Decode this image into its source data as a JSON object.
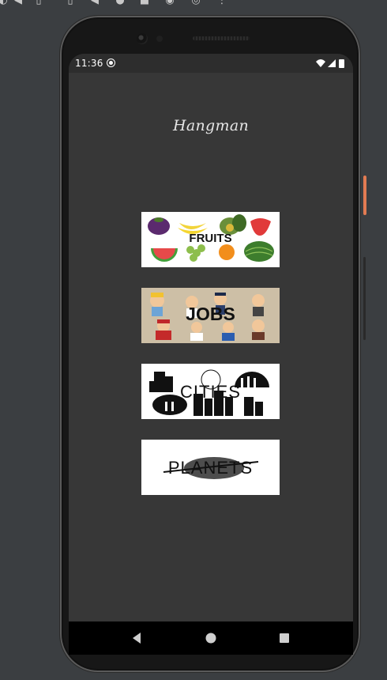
{
  "status_bar": {
    "time": "11:36"
  },
  "app": {
    "title": "Hangman"
  },
  "categories": [
    {
      "label": "FRUITS"
    },
    {
      "label": "JOBS"
    },
    {
      "label": "CITIES"
    },
    {
      "label": "PLANETS"
    }
  ],
  "nav": {
    "back_icon": "back-triangle-icon",
    "home_icon": "home-circle-icon",
    "recents_icon": "recents-square-icon"
  },
  "colors": {
    "app_background": "#373737",
    "status_bar": "#2d2d2d",
    "nav_bar": "#000000",
    "title_text": "#e6e6e6"
  }
}
